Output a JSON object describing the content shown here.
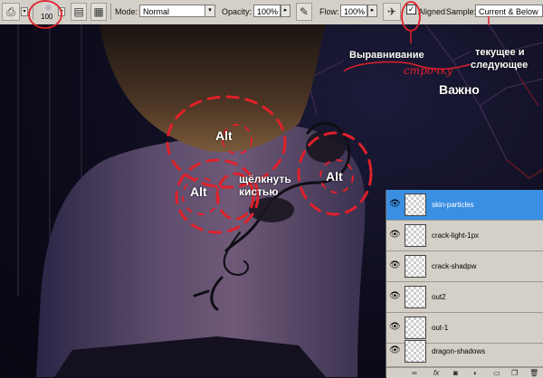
{
  "toolbar": {
    "brush_size": "100",
    "mode_label": "Mode:",
    "mode_value": "Normal",
    "opacity_label": "Opacity:",
    "opacity_value": "100%",
    "flow_label": "Flow:",
    "flow_value": "100%",
    "aligned_label": "Aligned",
    "aligned_checked": "✓",
    "sample_label": "Sample:",
    "sample_value": "Current & Below"
  },
  "annotations": {
    "alignment": "Выравнивание",
    "alignment_handwritten": "строчку",
    "current_below_line1": "текущее и",
    "current_below_line2": "следующее",
    "important": "Важно",
    "alt1": "Alt",
    "alt2": "Alt",
    "alt3": "Alt",
    "click_line1": "щёлкнуть",
    "click_line2": "кистью"
  },
  "layers": [
    {
      "name": "skin-particles",
      "selected": true
    },
    {
      "name": "crack-light-1px",
      "selected": false
    },
    {
      "name": "crack-shadpw",
      "selected": false
    },
    {
      "name": "out2",
      "selected": false
    },
    {
      "name": "out-1",
      "selected": false
    },
    {
      "name": "dragon-shadows",
      "selected": false
    }
  ],
  "colors": {
    "annotation_red": "#e0202a",
    "selection_blue": "#3a8fe3",
    "toolbar_gray": "#d4d0c8"
  }
}
